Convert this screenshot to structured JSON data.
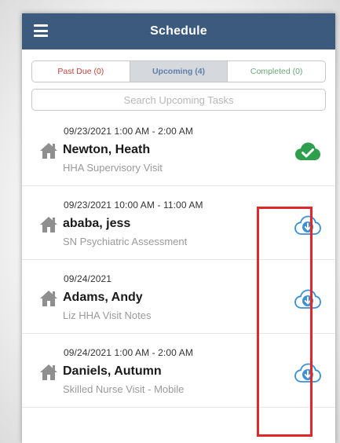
{
  "header": {
    "title": "Schedule",
    "menu_icon": "hamburger-menu-icon"
  },
  "tabs": [
    {
      "label": "Past Due (0)",
      "color": "#c0443c"
    },
    {
      "label": "Upcoming (4)",
      "color": "#5f7fa8",
      "selected": true
    },
    {
      "label": "Completed (0)",
      "color": "#6aa67a"
    }
  ],
  "search": {
    "placeholder": "Search Upcoming Tasks",
    "value": ""
  },
  "tasks": [
    {
      "datetime": "09/23/2021  1:00 AM - 2:00 AM",
      "name": "Newton, Heath",
      "type": "HHA Supervisory Visit",
      "status_icon": "cloud-check-icon",
      "status_color": "#2e9e4f"
    },
    {
      "datetime": "09/23/2021  10:00 AM - 11:00 AM",
      "name": "ababa, jess",
      "type": "SN Psychiatric Assessment",
      "status_icon": "cloud-download-icon",
      "status_color": "#3b8fd6"
    },
    {
      "datetime": "09/24/2021",
      "name": "Adams, Andy",
      "type": "Liz HHA Visit Notes",
      "status_icon": "cloud-download-icon",
      "status_color": "#3b8fd6"
    },
    {
      "datetime": "09/24/2021  1:00 AM - 2:00 AM",
      "name": "Daniels, Autumn",
      "type": "Skilled Nurse Visit - Mobile",
      "status_icon": "cloud-download-icon",
      "status_color": "#3b8fd6"
    }
  ],
  "colors": {
    "header_bg": "#3c5a7d",
    "highlight": "#e0282b",
    "home_icon": "#8f8f8f"
  }
}
